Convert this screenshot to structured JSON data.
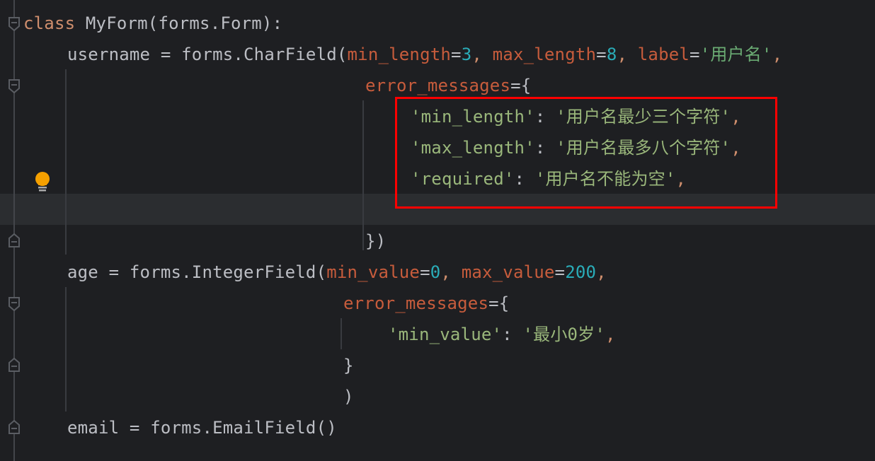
{
  "editor": {
    "language": "python",
    "colors": {
      "background": "#1e1f22",
      "current_line": "#2b2d30",
      "keyword": "#cf8e6d",
      "parameter": "#c75c3c",
      "number": "#2aacb8",
      "string": "#6aab73",
      "default": "#bcbec4",
      "annotation_box": "#ff0000",
      "bulb": "#f5a000"
    },
    "lines": [
      {
        "kw": "class",
        "rest": " MyForm(forms.Form):"
      },
      {
        "lhs": "username = forms.CharField(",
        "p1": "min_length",
        "eq1": "=",
        "v1": "3",
        "c1": ", ",
        "p2": "max_length",
        "eq2": "=",
        "v2": "8",
        "c2": ", ",
        "p3": "label",
        "eq3": "=",
        "v3": "'用户名'",
        "c3": ","
      },
      {
        "p": "error_messages",
        "rest": "={"
      },
      {
        "k": "'min_length'",
        "sep": ": ",
        "v": "'用户名最少三个字符'",
        "c": ","
      },
      {
        "k": "'max_length'",
        "sep": ": ",
        "v": "'用户名最多八个字符'",
        "c": ","
      },
      {
        "k": "'required'",
        "sep": ": ",
        "v": "'用户名不能为空'",
        "c": ","
      },
      {
        "text": ""
      },
      {
        "text": "})"
      },
      {
        "lhs": "age = forms.IntegerField(",
        "p1": "min_value",
        "eq1": "=",
        "v1": "0",
        "c1": ", ",
        "p2": "max_value",
        "eq2": "=",
        "v2": "200",
        "c2": ","
      },
      {
        "p": "error_messages",
        "rest": "={"
      },
      {
        "k": "'min_value'",
        "sep": ": ",
        "v": "'最小0岁'",
        "c": ","
      },
      {
        "text": "}"
      },
      {
        "text": ")"
      },
      {
        "text": "email = forms.EmailField()"
      }
    ],
    "gutter_icons": [
      "fold-start-icon",
      "intention-bulb-icon",
      "fold-end-icon"
    ]
  }
}
